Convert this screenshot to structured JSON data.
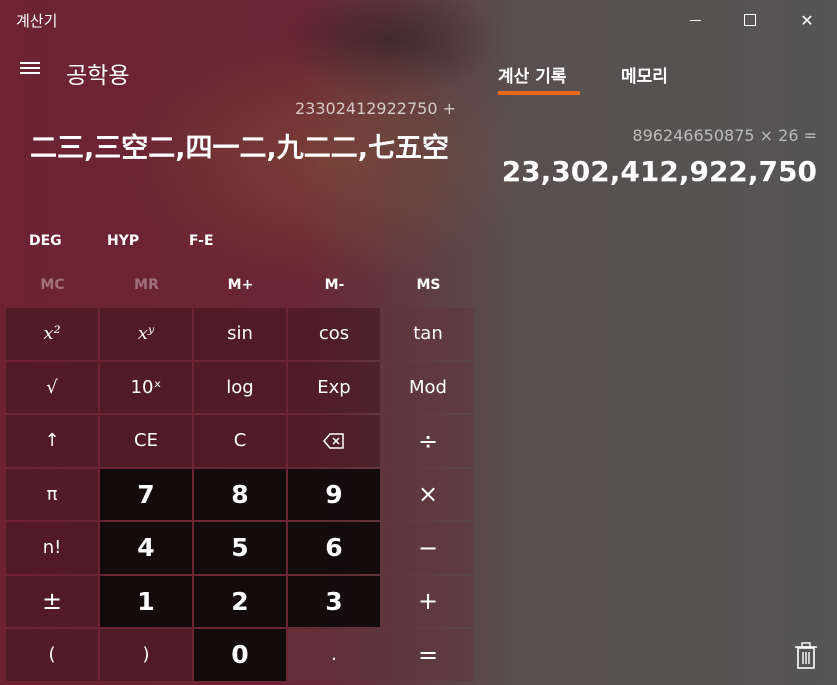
{
  "window": {
    "title": "계산기",
    "minimize_icon": "minimize-icon",
    "maximize_icon": "maximize-icon",
    "close_icon": "close-icon",
    "close_glyph": "✕"
  },
  "header": {
    "menu_icon": "hamburger-icon",
    "mode_title": "공학용"
  },
  "display": {
    "expression": "23302412922750  +",
    "value": "二三,三空二,四一二,九二二,七五空"
  },
  "modes": {
    "angle": "DEG",
    "hyp": "HYP",
    "fe": "F-E"
  },
  "memory": [
    {
      "label": "MC",
      "enabled": false
    },
    {
      "label": "MR",
      "enabled": false
    },
    {
      "label": "M+",
      "enabled": true
    },
    {
      "label": "M-",
      "enabled": true
    },
    {
      "label": "MS",
      "enabled": true
    }
  ],
  "keys": [
    {
      "name": "square-key",
      "label": "𝑥²",
      "kind": "fn"
    },
    {
      "name": "power-key",
      "label": "𝑥ʸ",
      "kind": "fn"
    },
    {
      "name": "sin-key",
      "label": "sin",
      "kind": "fn"
    },
    {
      "name": "cos-key",
      "label": "cos",
      "kind": "fn"
    },
    {
      "name": "tan-key",
      "label": "tan",
      "kind": "op"
    },
    {
      "name": "sqrt-key",
      "label": "√",
      "kind": "fn"
    },
    {
      "name": "ten-power-key",
      "label": "10ˣ",
      "kind": "fn"
    },
    {
      "name": "log-key",
      "label": "log",
      "kind": "fn"
    },
    {
      "name": "exp-key",
      "label": "Exp",
      "kind": "fn"
    },
    {
      "name": "mod-key",
      "label": "Mod",
      "kind": "op"
    },
    {
      "name": "shift-key",
      "label": "↑",
      "kind": "fn"
    },
    {
      "name": "clear-entry-key",
      "label": "CE",
      "kind": "fn"
    },
    {
      "name": "clear-key",
      "label": "C",
      "kind": "fn"
    },
    {
      "name": "backspace-key",
      "label": "",
      "kind": "fn",
      "icon": "backspace-icon"
    },
    {
      "name": "divide-key",
      "label": "÷",
      "kind": "op"
    },
    {
      "name": "pi-key",
      "label": "π",
      "kind": "fn"
    },
    {
      "name": "digit-7-key",
      "label": "7",
      "kind": "num"
    },
    {
      "name": "digit-8-key",
      "label": "8",
      "kind": "num"
    },
    {
      "name": "digit-9-key",
      "label": "9",
      "kind": "num"
    },
    {
      "name": "multiply-key",
      "label": "×",
      "kind": "op"
    },
    {
      "name": "factorial-key",
      "label": "n!",
      "kind": "fn"
    },
    {
      "name": "digit-4-key",
      "label": "4",
      "kind": "num"
    },
    {
      "name": "digit-5-key",
      "label": "5",
      "kind": "num"
    },
    {
      "name": "digit-6-key",
      "label": "6",
      "kind": "num"
    },
    {
      "name": "minus-key",
      "label": "−",
      "kind": "op"
    },
    {
      "name": "negate-key",
      "label": "±",
      "kind": "fn"
    },
    {
      "name": "digit-1-key",
      "label": "1",
      "kind": "num"
    },
    {
      "name": "digit-2-key",
      "label": "2",
      "kind": "num"
    },
    {
      "name": "digit-3-key",
      "label": "3",
      "kind": "num"
    },
    {
      "name": "plus-key",
      "label": "+",
      "kind": "op"
    },
    {
      "name": "open-paren-key",
      "label": "(",
      "kind": "fn"
    },
    {
      "name": "close-paren-key",
      "label": ")",
      "kind": "fn"
    },
    {
      "name": "digit-0-key",
      "label": "0",
      "kind": "num"
    },
    {
      "name": "decimal-key",
      "label": ".",
      "kind": "op"
    },
    {
      "name": "equals-key",
      "label": "=",
      "kind": "op"
    }
  ],
  "side_panel": {
    "tabs": [
      {
        "label": "계산 기록",
        "active": true
      },
      {
        "label": "메모리",
        "active": false
      }
    ],
    "accent_color": "#e66a1a",
    "history": [
      {
        "expression": "896246650875   ×   26 =",
        "result": "23,302,412,922,750"
      }
    ],
    "delete_icon": "trash-icon"
  }
}
